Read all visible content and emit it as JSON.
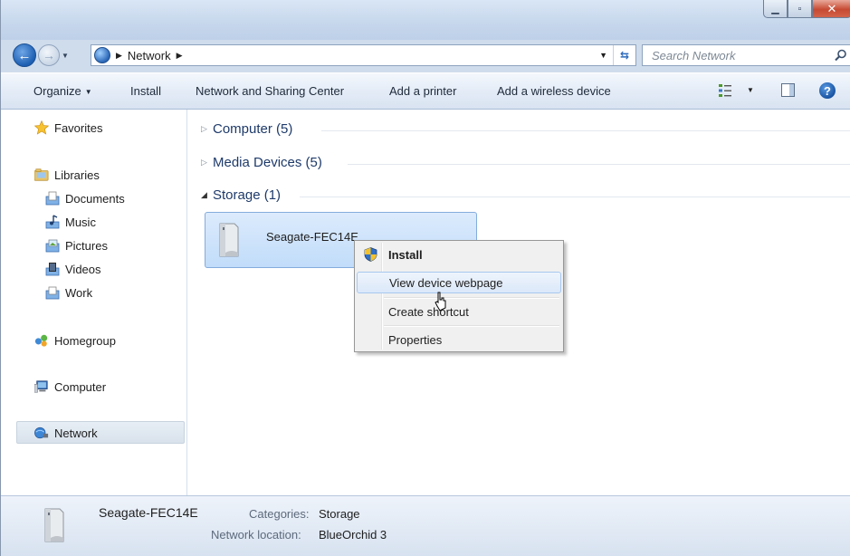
{
  "window": {
    "caption_buttons": [
      "minimize",
      "maximize",
      "close"
    ]
  },
  "address": {
    "root_icon": "network-globe-icon",
    "crumb": "Network",
    "separator": "▶"
  },
  "search": {
    "placeholder": "Search Network"
  },
  "toolbar": {
    "organize": "Organize",
    "install": "Install",
    "network_center": "Network and Sharing Center",
    "add_printer": "Add a printer",
    "add_wireless": "Add a wireless device"
  },
  "nav": {
    "favorites": "Favorites",
    "libraries": "Libraries",
    "library_items": [
      "Documents",
      "Music",
      "Pictures",
      "Videos",
      "Work"
    ],
    "homegroup": "Homegroup",
    "computer": "Computer",
    "network": "Network",
    "selected": "Network"
  },
  "content": {
    "groups": [
      {
        "title": "Computer (5)",
        "expanded": false
      },
      {
        "title": "Media Devices (5)",
        "expanded": false
      },
      {
        "title": "Storage (1)",
        "expanded": true
      }
    ],
    "storage_item": {
      "name": "Seagate-FEC14E",
      "icon": "storage-drive-icon"
    }
  },
  "context_menu": {
    "items": [
      {
        "label": "Install",
        "bold": true,
        "icon": "uac-shield-icon"
      },
      {
        "label": "View device webpage",
        "highlighted": true
      },
      {
        "label": "Create shortcut"
      },
      {
        "label": "Properties"
      }
    ]
  },
  "details": {
    "name": "Seagate-FEC14E",
    "categories_label": "Categories:",
    "categories_value": "Storage",
    "location_label": "Network location:",
    "location_value": "BlueOrchid 3"
  },
  "colors": {
    "selection": "#c1dcfa",
    "header_text": "#1e3a6a",
    "close_button": "#c74a33"
  }
}
